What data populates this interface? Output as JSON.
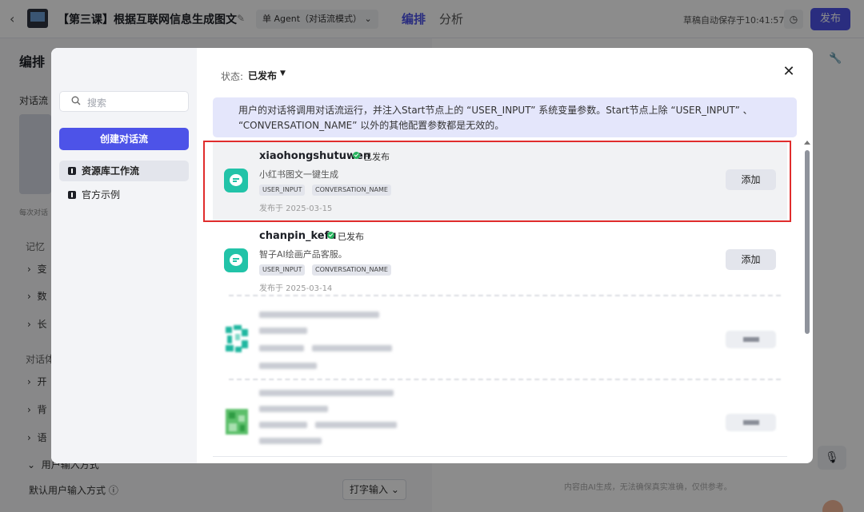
{
  "topbar": {
    "back_icon": "chevron-left-icon",
    "app_title": "【第三课】根据互联网信息生成图文",
    "mode_label": "单 Agent（对话流模式）",
    "tab_edit": "编排",
    "tab_analysis": "分析",
    "autosave": "草稿自动保存于10:41:57",
    "publish": "发布"
  },
  "background": {
    "heading": "编排",
    "dialog_flow_label": "对话流",
    "note": "每次对话",
    "memory_label": "记忆",
    "memory_items": [
      "变",
      "数",
      "长"
    ],
    "experience_label": "对话体",
    "experience_items": [
      "开",
      "背",
      "语"
    ],
    "user_input_label": "用户输入方式",
    "default_input_label": "默认用户输入方式",
    "default_input_value": "打字输入",
    "disclaimer": "内容由AI生成，无法确保真实准确，仅供参考。"
  },
  "modal": {
    "search_placeholder": "搜索",
    "create_button": "创建对话流",
    "side_items": [
      {
        "label": "资源库工作流",
        "active": true
      },
      {
        "label": "官方示例",
        "active": false
      }
    ],
    "status_label": "状态:",
    "status_value": "已发布",
    "info_line1": "用户的对话将调用对话流运行，并注入Start节点上的 “USER_INPUT” 系统变量参数。Start节点上除 “USER_INPUT” 、",
    "info_line2": "“CONVERSATION_NAME” 以外的其他配置参数都是无效的。",
    "workflows": [
      {
        "name": "xiaohongshutuwen",
        "status": "已发布",
        "description": "小红书图文一键生成",
        "tags": [
          "USER_INPUT",
          "CONVERSATION_NAME"
        ],
        "published": "发布于 2025-03-15",
        "action": "添加",
        "selected": true
      },
      {
        "name": "chanpin_kefu",
        "status": "已发布",
        "description": "智子AI绘画产品客服。",
        "tags": [
          "USER_INPUT",
          "CONVERSATION_NAME"
        ],
        "published": "发布于 2025-03-14",
        "action": "添加",
        "selected": false
      }
    ]
  },
  "colors": {
    "accent": "#4d53e8",
    "published_green": "#27b35e",
    "workflow_icon": "#22c3a8",
    "highlight_border": "#e02d2d"
  }
}
